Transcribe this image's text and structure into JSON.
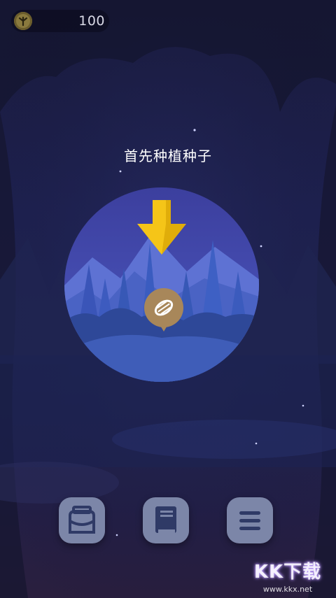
{
  "coins": {
    "value": "100",
    "icon": "coin-tree-icon"
  },
  "instruction": "首先种植种子",
  "seed_button": {
    "icon": "seed-icon"
  },
  "bottom_bar": {
    "buttons": [
      {
        "icon": "backpack-icon"
      },
      {
        "icon": "book-icon"
      },
      {
        "icon": "menu-icon"
      }
    ]
  },
  "watermark": {
    "title": "KK下载",
    "url": "www.kkx.net"
  },
  "colors": {
    "arrow": "#f5c518",
    "seed_badge": "#a8875a",
    "button_bg": "#7c86a8",
    "planet_sky": "#4347a8"
  }
}
